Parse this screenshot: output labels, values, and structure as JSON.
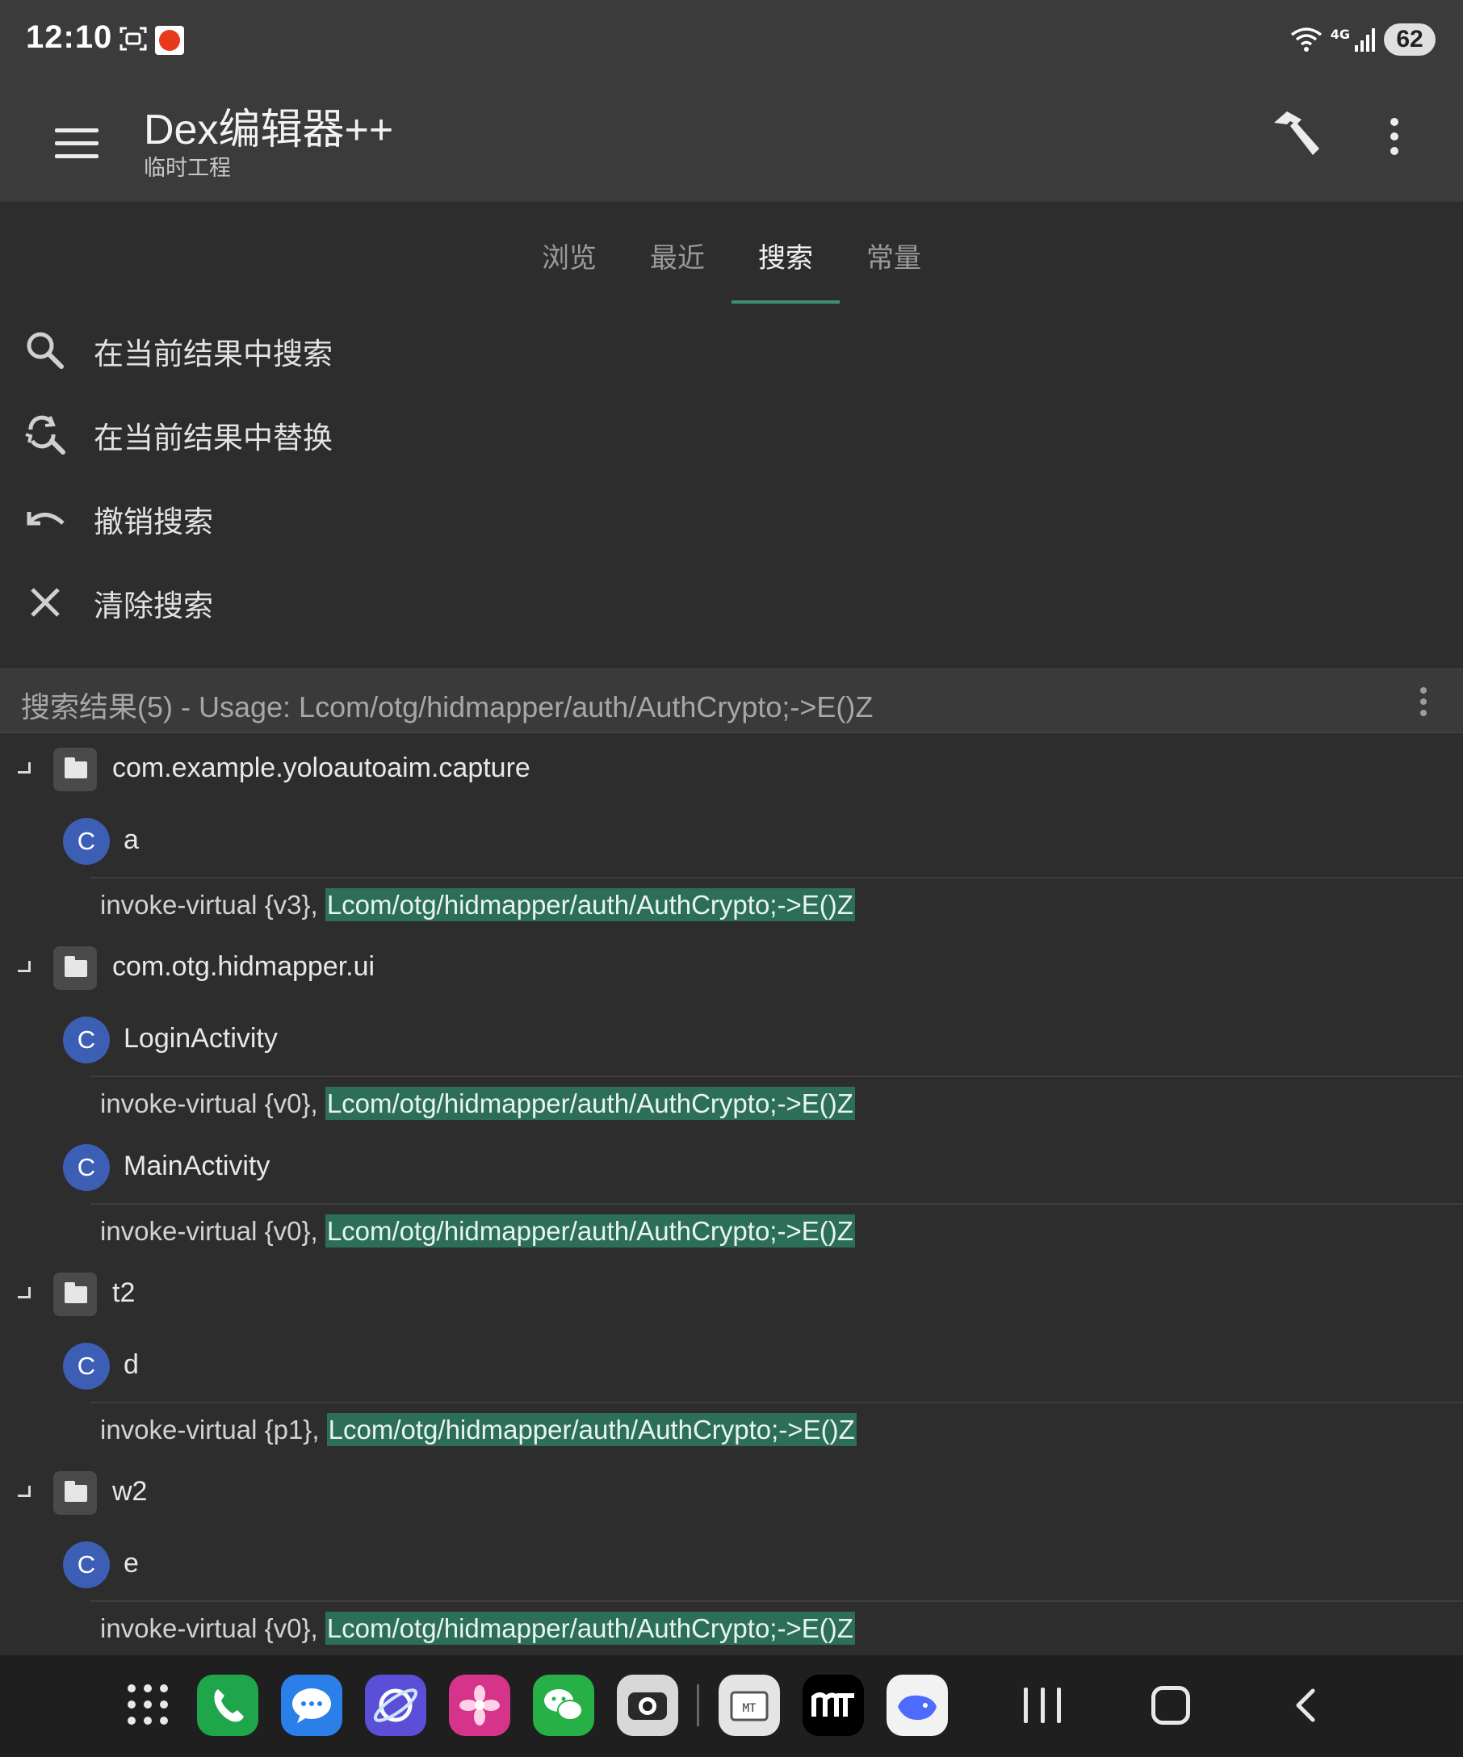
{
  "status_bar": {
    "time": "12:10",
    "network": "4G",
    "battery": "62"
  },
  "app_bar": {
    "title": "Dex编辑器++",
    "subtitle": "临时工程"
  },
  "tabs": [
    {
      "label": "浏览",
      "active": false
    },
    {
      "label": "最近",
      "active": false
    },
    {
      "label": "搜索",
      "active": true
    },
    {
      "label": "常量",
      "active": false
    }
  ],
  "actions": [
    {
      "label": "在当前结果中搜索",
      "icon": "search-icon"
    },
    {
      "label": "在当前结果中替换",
      "icon": "find-replace-icon"
    },
    {
      "label": "撤销搜索",
      "icon": "undo-icon"
    },
    {
      "label": "清除搜索",
      "icon": "close-icon"
    }
  ],
  "results": {
    "header": "搜索结果(5) - Usage: Lcom/otg/hidmapper/auth/AuthCrypto;->E()Z",
    "packages": [
      {
        "name": "com.example.yoloautoaim.capture",
        "classes": [
          {
            "badge": "C",
            "name": "a",
            "code_prefix": "invoke-virtual {v3}, ",
            "code_match": "Lcom/otg/hidmapper/auth/AuthCrypto;->E()Z"
          }
        ]
      },
      {
        "name": "com.otg.hidmapper.ui",
        "classes": [
          {
            "badge": "C",
            "name": "LoginActivity",
            "code_prefix": "invoke-virtual {v0}, ",
            "code_match": "Lcom/otg/hidmapper/auth/AuthCrypto;->E()Z"
          },
          {
            "badge": "C",
            "name": "MainActivity",
            "code_prefix": "invoke-virtual {v0}, ",
            "code_match": "Lcom/otg/hidmapper/auth/AuthCrypto;->E()Z"
          }
        ]
      },
      {
        "name": "t2",
        "classes": [
          {
            "badge": "C",
            "name": "d",
            "code_prefix": "invoke-virtual {p1}, ",
            "code_match": "Lcom/otg/hidmapper/auth/AuthCrypto;->E()Z"
          }
        ]
      },
      {
        "name": "w2",
        "classes": [
          {
            "badge": "C",
            "name": "e",
            "code_prefix": "invoke-virtual {v0}, ",
            "code_match": "Lcom/otg/hidmapper/auth/AuthCrypto;->E()Z"
          }
        ]
      }
    ]
  },
  "dock": {
    "apps": [
      {
        "name": "phone-app",
        "color": "#1fa64a"
      },
      {
        "name": "messages-app",
        "color": "#2b7fe8"
      },
      {
        "name": "internet-app",
        "color": "#5a4fd6"
      },
      {
        "name": "gallery-app",
        "color": "#d6338a"
      },
      {
        "name": "wechat-app",
        "color": "#27b045"
      },
      {
        "name": "camera-app",
        "color": "#d8d8d8"
      },
      {
        "name": "mt-manager-app",
        "color": "#e4e4e4"
      },
      {
        "name": "mt-app",
        "color": "#000000"
      },
      {
        "name": "deepseek-app",
        "color": "#f2f2f2"
      }
    ]
  },
  "colors": {
    "accent": "#3d8f76",
    "highlight": "#2c6e58",
    "class_badge": "#3c5fb5",
    "background": "#2d2d2d",
    "bar": "#3b3b3b"
  }
}
